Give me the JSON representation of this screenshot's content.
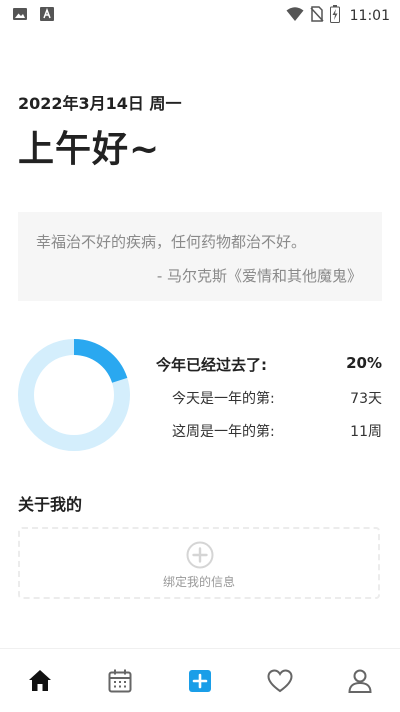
{
  "status_bar": {
    "time": "11:01",
    "icons": [
      "image-icon",
      "text-a-icon",
      "wifi-icon",
      "no-sim-icon",
      "battery-charging-icon"
    ]
  },
  "header": {
    "date": "2022年3月14日 周一",
    "greeting": "上午好~"
  },
  "quote": {
    "text": "幸福治不好的疾病，任何药物都治不好。",
    "author": "- 马尔克斯《爱情和其他魔鬼》"
  },
  "year_progress": {
    "title": "今年已经过去了:",
    "percent_label": "20%",
    "percent_value": 20,
    "rows": [
      {
        "label": "今天是一年的第:",
        "value": "73天"
      },
      {
        "label": "这周是一年的第:",
        "value": "11周"
      }
    ],
    "colors": {
      "progress": "#2aa8f0",
      "track": "#d4eefc"
    }
  },
  "about": {
    "title": "关于我的",
    "bind_label": "绑定我的信息",
    "icon": "add-circle-icon"
  },
  "tab_bar": {
    "items": [
      "home-icon",
      "calendar-icon",
      "add-icon",
      "heart-icon",
      "user-icon"
    ],
    "accent": "#1a9ee8"
  }
}
